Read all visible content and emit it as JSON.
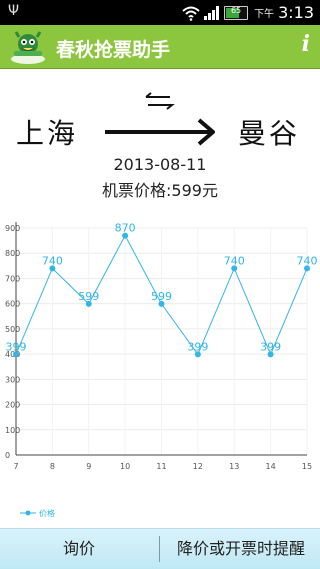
{
  "status_bar": {
    "battery_level": "65",
    "ampm": "下午",
    "time": "3:13",
    "icons": [
      "usb-icon",
      "wifi-icon",
      "signal-icon",
      "battery-icon"
    ]
  },
  "app_bar": {
    "title": "春秋抢票助手",
    "info_label": "i",
    "background": "#8cc63f"
  },
  "route": {
    "from_city": "上海",
    "to_city": "曼谷",
    "date": "2013-08-11",
    "price_label": "机票价格:599元"
  },
  "chart_data": {
    "type": "line",
    "x": [
      7,
      8,
      9,
      10,
      11,
      12,
      13,
      14,
      15
    ],
    "series": [
      {
        "name": "价格",
        "values": [
          399,
          740,
          599,
          870,
          599,
          399,
          740,
          399,
          740
        ],
        "color": "#33b5e5"
      }
    ],
    "xlim": [
      7,
      15
    ],
    "ylim": [
      0,
      900
    ],
    "yticks": [
      0,
      100,
      200,
      300,
      400,
      500,
      600,
      700,
      800,
      900
    ],
    "xticks": [
      7,
      8,
      9,
      10,
      11,
      12,
      13,
      14,
      15
    ],
    "grid": true,
    "legend": "bottom-left",
    "data_labels": true
  },
  "bottom_bar": {
    "query_label": "询价",
    "alert_label": "降价或开票时提醒"
  }
}
